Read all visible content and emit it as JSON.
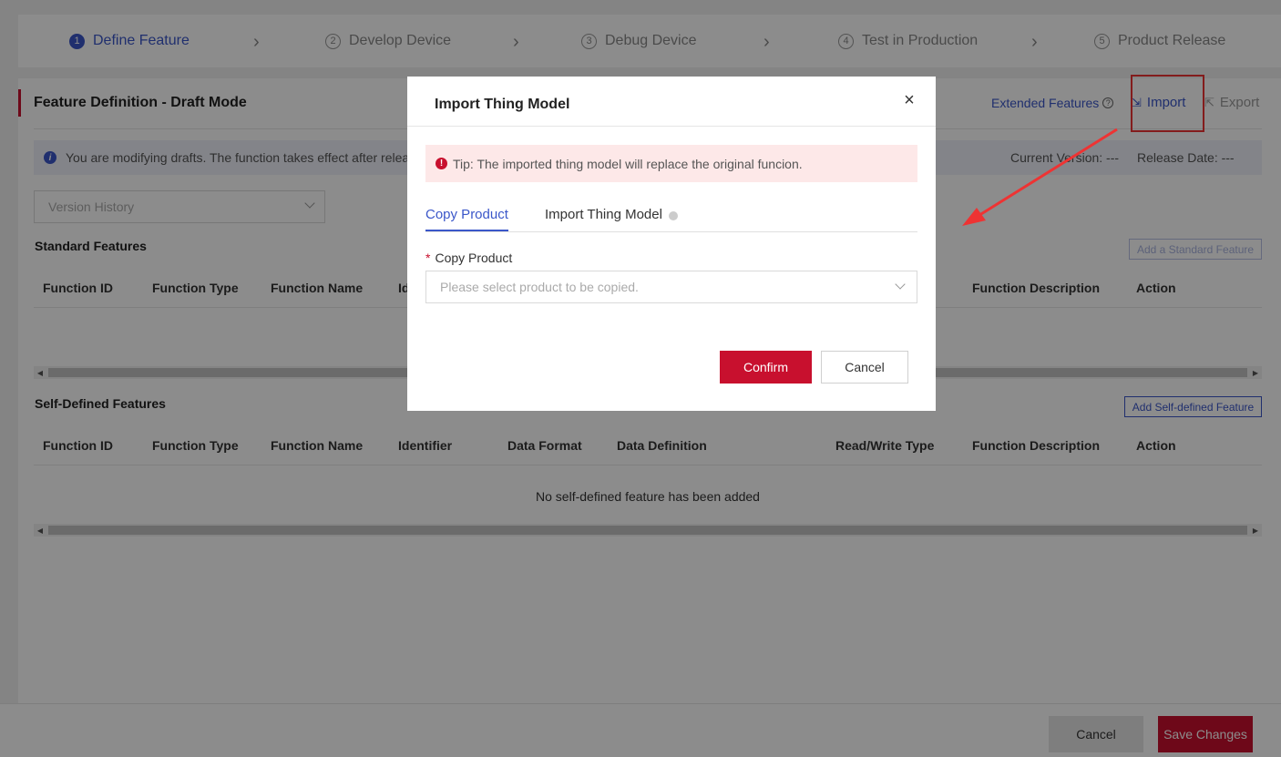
{
  "steps": [
    {
      "num": "1",
      "label": "Define Feature",
      "active": true
    },
    {
      "num": "2",
      "label": "Develop Device"
    },
    {
      "num": "3",
      "label": "Debug Device"
    },
    {
      "num": "4",
      "label": "Test in Production"
    },
    {
      "num": "5",
      "label": "Product Release"
    }
  ],
  "panel": {
    "title": "Feature Definition - Draft Mode",
    "extended_features": "Extended Features",
    "import_label": "Import",
    "export_label": "Export",
    "notice": "You are modifying drafts. The function takes effect after relea",
    "current_version": "Current Version: ---",
    "release_date": "Release Date: ---",
    "version_history_placeholder": "Version History"
  },
  "standard": {
    "title": "Standard Features",
    "add_button": "Add a Standard Feature",
    "columns": [
      "Function ID",
      "Function Type",
      "Function Name",
      "Id",
      "Function Description",
      "Action"
    ]
  },
  "self_defined": {
    "title": "Self-Defined Features",
    "add_button": "Add Self-defined Feature",
    "columns": [
      "Function ID",
      "Function Type",
      "Function Name",
      "Identifier",
      "Data Format",
      "Data Definition",
      "Read/Write Type",
      "Function Description",
      "Action"
    ],
    "empty": "No self-defined feature has been added"
  },
  "footer": {
    "cancel": "Cancel",
    "save": "Save Changes"
  },
  "modal": {
    "title": "Import Thing Model",
    "close": "×",
    "tip": "Tip: The imported thing model will replace the original funcion.",
    "tabs": [
      "Copy Product",
      "Import Thing Model"
    ],
    "field_label": "Copy Product",
    "select_placeholder": "Please select product to be copied.",
    "confirm": "Confirm",
    "cancel": "Cancel"
  },
  "colors": {
    "accent": "#3b57c9",
    "brand_red": "#c8102e",
    "annotation_red": "#ee3333"
  }
}
